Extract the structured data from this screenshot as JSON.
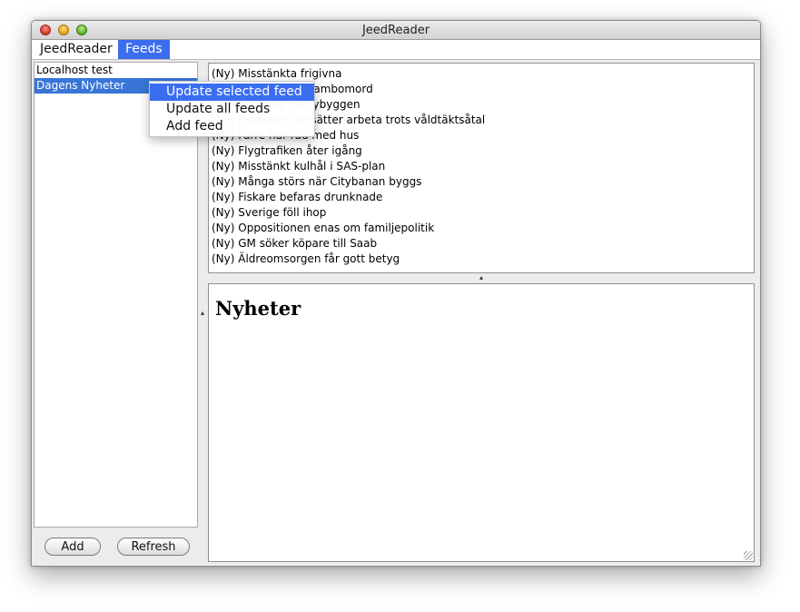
{
  "window": {
    "title": "JeedReader"
  },
  "menubar": {
    "items": [
      {
        "label": "JeedReader"
      },
      {
        "label": "Feeds"
      }
    ]
  },
  "feeds_menu": {
    "items": [
      {
        "label": "Update selected feed"
      },
      {
        "label": "Update all feeds"
      },
      {
        "label": "Add feed"
      }
    ]
  },
  "sidebar": {
    "feeds": [
      {
        "label": "Localhost test"
      },
      {
        "label": "Dagens Nyheter"
      }
    ],
    "add_label": "Add",
    "refresh_label": "Refresh"
  },
  "headlines": [
    {
      "text": "(Ny) Misstänkta frigivna"
    },
    {
      "text": "(Ny) Fängelse för sambomord"
    },
    {
      "text": "(Ny) Satsning på nybyggen"
    },
    {
      "text": "(Ny) Psykiater fortsätter arbeta trots våldtäktsåtal"
    },
    {
      "text": "(Ny) Färre har råd med hus"
    },
    {
      "text": "(Ny) Flygtrafiken åter igång"
    },
    {
      "text": "(Ny) Misstänkt kulhål i SAS-plan"
    },
    {
      "text": "(Ny) Många störs när Citybanan byggs"
    },
    {
      "text": "(Ny) Fiskare befaras drunknade"
    },
    {
      "text": "(Ny) Sverige föll ihop"
    },
    {
      "text": "(Ny) Oppositionen enas om familjepolitik"
    },
    {
      "text": "(Ny) GM söker köpare till Saab"
    },
    {
      "text": "(Ny) Äldreomsorgen får gott betyg"
    }
  ],
  "content": {
    "title": "Nyheter"
  },
  "colors": {
    "selection": "#3875d7",
    "menu_highlight": "#3a6df0"
  }
}
